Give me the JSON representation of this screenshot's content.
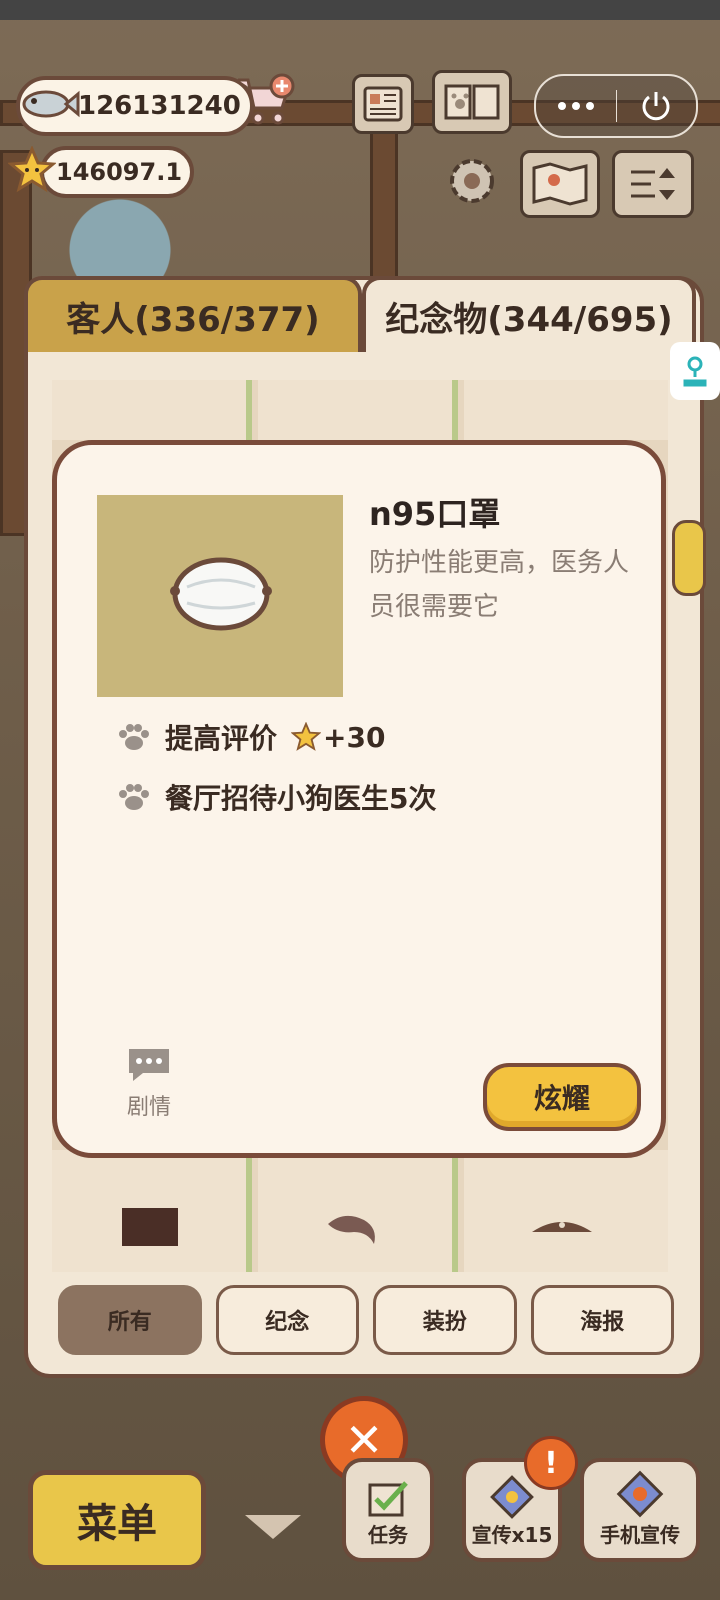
{
  "currency": {
    "fish": "126131240",
    "stars": "146097.1"
  },
  "tabs": [
    {
      "label": "客人(336/377)"
    },
    {
      "label": "纪念物(344/695)"
    }
  ],
  "modal": {
    "item_name": "n95口罩",
    "description": "防护性能更高，医务人员很需要它",
    "effects": [
      {
        "text": "提高评价",
        "bonus": "+30"
      },
      {
        "text": "餐厅招待小狗医生5次"
      }
    ],
    "story_label": "剧情",
    "show_button": "炫耀"
  },
  "filters": [
    {
      "label": "所有",
      "active": true
    },
    {
      "label": "纪念",
      "active": false
    },
    {
      "label": "装扮",
      "active": false
    },
    {
      "label": "海报",
      "active": false
    }
  ],
  "bottom": {
    "menu": "菜单",
    "tasks": "任务",
    "promo": "宣传x15",
    "phone_promo": "手机宣传",
    "alert": "!"
  },
  "colors": {
    "panel_border": "#6b4a3a",
    "tab_active": "#c9a24a",
    "button_yellow": "#f3c23f",
    "close_orange": "#e86b2a"
  }
}
